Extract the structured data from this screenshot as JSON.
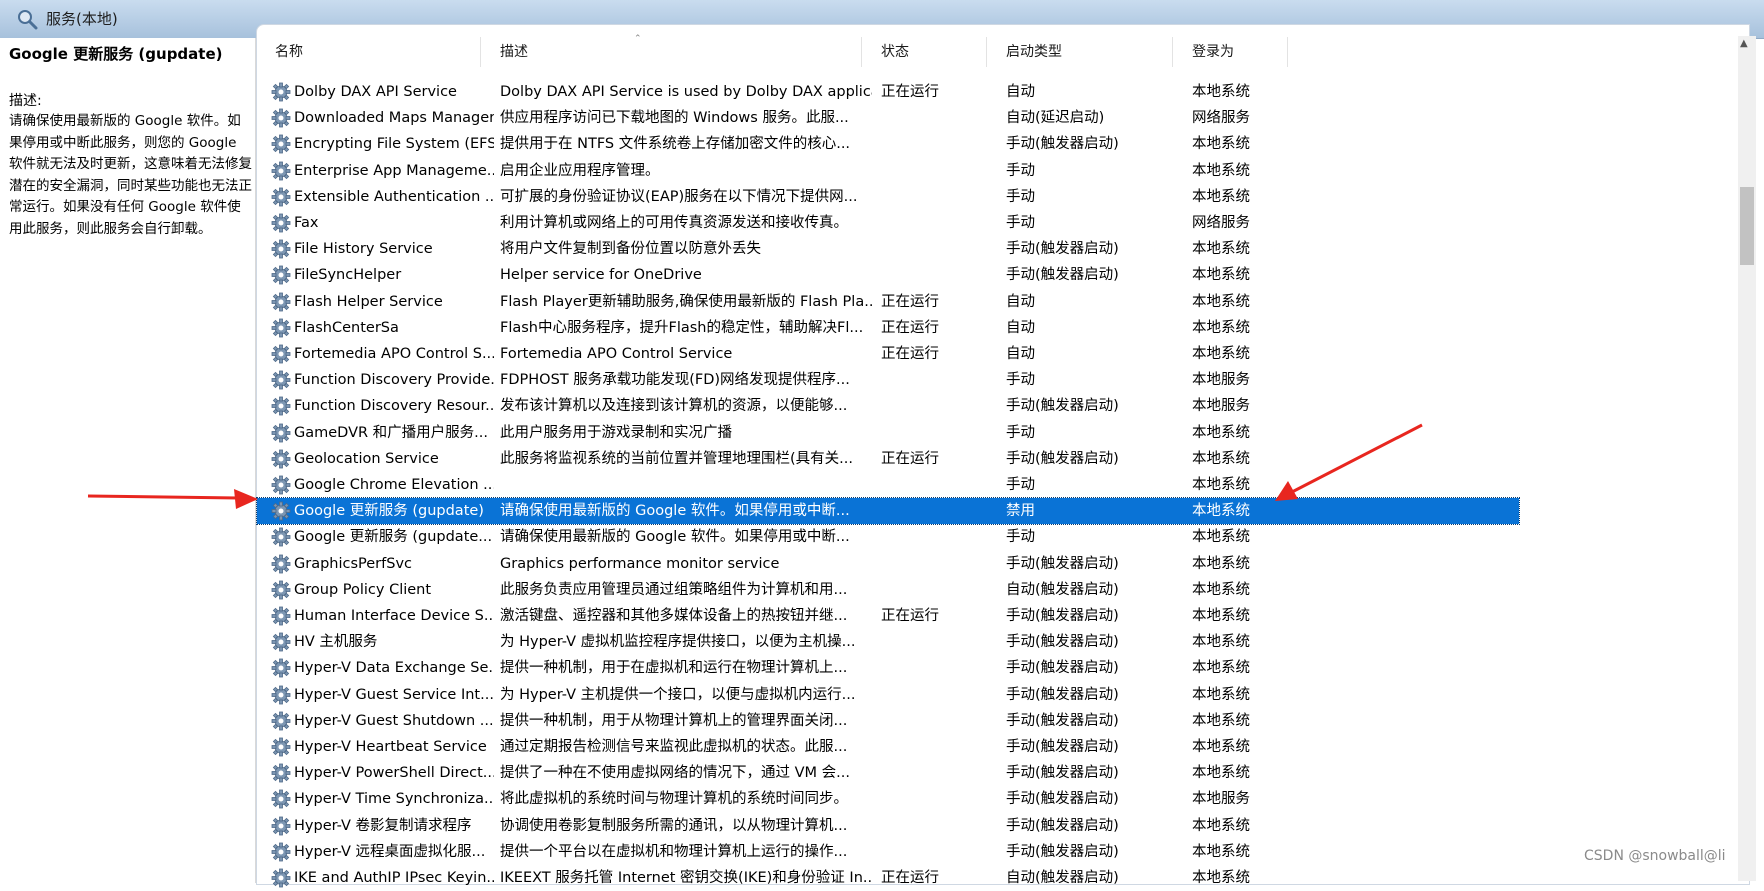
{
  "window": {
    "title": "服务(本地)"
  },
  "description_pane": {
    "service_name": "Google 更新服务 (gupdate)",
    "label": "描述:",
    "text": "请确保使用最新版的 Google 软件。如果停用或中断此服务，则您的 Google 软件就无法及时更新，这意味着无法修复潜在的安全漏洞，同时某些功能也无法正常运行。如果没有任何 Google 软件使用此服务，则此服务会自行卸载。"
  },
  "columns": {
    "name": "名称",
    "description": "描述",
    "status": "状态",
    "startup": "启动类型",
    "logon": "登录为"
  },
  "rows": [
    {
      "name": "Dolby DAX API Service",
      "description": "Dolby DAX API Service is used by Dolby DAX applica...",
      "status": "正在运行",
      "startup": "自动",
      "logon": "本地系统"
    },
    {
      "name": "Downloaded Maps Manager",
      "description": "供应用程序访问已下载地图的 Windows 服务。此服...",
      "status": "",
      "startup": "自动(延迟启动)",
      "logon": "网络服务"
    },
    {
      "name": "Encrypting File System (EFS)",
      "description": "提供用于在 NTFS 文件系统卷上存储加密文件的核心...",
      "status": "",
      "startup": "手动(触发器启动)",
      "logon": "本地系统"
    },
    {
      "name": "Enterprise App Manageme...",
      "description": "启用企业应用程序管理。",
      "status": "",
      "startup": "手动",
      "logon": "本地系统"
    },
    {
      "name": "Extensible Authentication ...",
      "description": "可扩展的身份验证协议(EAP)服务在以下情况下提供网...",
      "status": "",
      "startup": "手动",
      "logon": "本地系统"
    },
    {
      "name": "Fax",
      "description": "利用计算机或网络上的可用传真资源发送和接收传真。",
      "status": "",
      "startup": "手动",
      "logon": "网络服务"
    },
    {
      "name": "File History Service",
      "description": "将用户文件复制到备份位置以防意外丢失",
      "status": "",
      "startup": "手动(触发器启动)",
      "logon": "本地系统"
    },
    {
      "name": "FileSyncHelper",
      "description": "Helper service for OneDrive",
      "status": "",
      "startup": "手动(触发器启动)",
      "logon": "本地系统"
    },
    {
      "name": "Flash Helper Service",
      "description": "Flash Player更新辅助服务,确保使用最新版的 Flash Pla...",
      "status": "正在运行",
      "startup": "自动",
      "logon": "本地系统"
    },
    {
      "name": "FlashCenterSa",
      "description": "Flash中心服务程序，提升Flash的稳定性，辅助解决Fl...",
      "status": "正在运行",
      "startup": "自动",
      "logon": "本地系统"
    },
    {
      "name": "Fortemedia APO Control S...",
      "description": "Fortemedia APO Control Service",
      "status": "正在运行",
      "startup": "自动",
      "logon": "本地系统"
    },
    {
      "name": "Function Discovery Provide...",
      "description": "FDPHOST 服务承载功能发现(FD)网络发现提供程序...",
      "status": "",
      "startup": "手动",
      "logon": "本地服务"
    },
    {
      "name": "Function Discovery Resour...",
      "description": "发布该计算机以及连接到该计算机的资源，以便能够...",
      "status": "",
      "startup": "手动(触发器启动)",
      "logon": "本地服务"
    },
    {
      "name": "GameDVR 和广播用户服务...",
      "description": "此用户服务用于游戏录制和实况广播",
      "status": "",
      "startup": "手动",
      "logon": "本地系统"
    },
    {
      "name": "Geolocation Service",
      "description": "此服务将监视系统的当前位置并管理地理围栏(具有关...",
      "status": "正在运行",
      "startup": "手动(触发器启动)",
      "logon": "本地系统"
    },
    {
      "name": "Google Chrome Elevation ...",
      "description": "",
      "status": "",
      "startup": "手动",
      "logon": "本地系统"
    },
    {
      "name": "Google 更新服务 (gupdate)",
      "description": "请确保使用最新版的 Google 软件。如果停用或中断...",
      "status": "",
      "startup": "禁用",
      "logon": "本地系统",
      "selected": true
    },
    {
      "name": "Google 更新服务 (gupdate...",
      "description": "请确保使用最新版的 Google 软件。如果停用或中断...",
      "status": "",
      "startup": "手动",
      "logon": "本地系统"
    },
    {
      "name": "GraphicsPerfSvc",
      "description": "Graphics performance monitor service",
      "status": "",
      "startup": "手动(触发器启动)",
      "logon": "本地系统"
    },
    {
      "name": "Group Policy Client",
      "description": "此服务负责应用管理员通过组策略组件为计算机和用...",
      "status": "",
      "startup": "自动(触发器启动)",
      "logon": "本地系统"
    },
    {
      "name": "Human Interface Device S...",
      "description": "激活键盘、遥控器和其他多媒体设备上的热按钮并继...",
      "status": "正在运行",
      "startup": "手动(触发器启动)",
      "logon": "本地系统"
    },
    {
      "name": "HV 主机服务",
      "description": "为 Hyper-V 虚拟机监控程序提供接口，以便为主机操...",
      "status": "",
      "startup": "手动(触发器启动)",
      "logon": "本地系统"
    },
    {
      "name": "Hyper-V Data Exchange Se...",
      "description": "提供一种机制，用于在虚拟机和运行在物理计算机上...",
      "status": "",
      "startup": "手动(触发器启动)",
      "logon": "本地系统"
    },
    {
      "name": "Hyper-V Guest Service Int...",
      "description": "为 Hyper-V 主机提供一个接口，以便与虚拟机内运行...",
      "status": "",
      "startup": "手动(触发器启动)",
      "logon": "本地系统"
    },
    {
      "name": "Hyper-V Guest Shutdown ...",
      "description": "提供一种机制，用于从物理计算机上的管理界面关闭...",
      "status": "",
      "startup": "手动(触发器启动)",
      "logon": "本地系统"
    },
    {
      "name": "Hyper-V Heartbeat Service",
      "description": "通过定期报告检测信号来监视此虚拟机的状态。此服...",
      "status": "",
      "startup": "手动(触发器启动)",
      "logon": "本地系统"
    },
    {
      "name": "Hyper-V PowerShell Direct...",
      "description": "提供了一种在不使用虚拟网络的情况下，通过 VM 会...",
      "status": "",
      "startup": "手动(触发器启动)",
      "logon": "本地系统"
    },
    {
      "name": "Hyper-V Time Synchroniza...",
      "description": "将此虚拟机的系统时间与物理计算机的系统时间同步。",
      "status": "",
      "startup": "手动(触发器启动)",
      "logon": "本地服务"
    },
    {
      "name": "Hyper-V 卷影复制请求程序",
      "description": "协调使用卷影复制服务所需的通讯，以从物理计算机...",
      "status": "",
      "startup": "手动(触发器启动)",
      "logon": "本地系统"
    },
    {
      "name": "Hyper-V 远程桌面虚拟化服...",
      "description": "提供一个平台以在虚拟机和物理计算机上运行的操作...",
      "status": "",
      "startup": "手动(触发器启动)",
      "logon": "本地系统"
    },
    {
      "name": "IKE and AuthIP IPsec Keyin...",
      "description": "IKEEXT 服务托管 Internet 密钥交换(IKE)和身份验证 In...",
      "status": "正在运行",
      "startup": "自动(触发器启动)",
      "logon": "本地系统"
    }
  ],
  "watermark": "CSDN @snowball@li",
  "icons": {
    "header": "services-search-icon",
    "row": "gear-icon"
  },
  "colors": {
    "selection": "#0a73d6",
    "arrow": "#e8261f",
    "header_bg": "#b6cce3"
  }
}
